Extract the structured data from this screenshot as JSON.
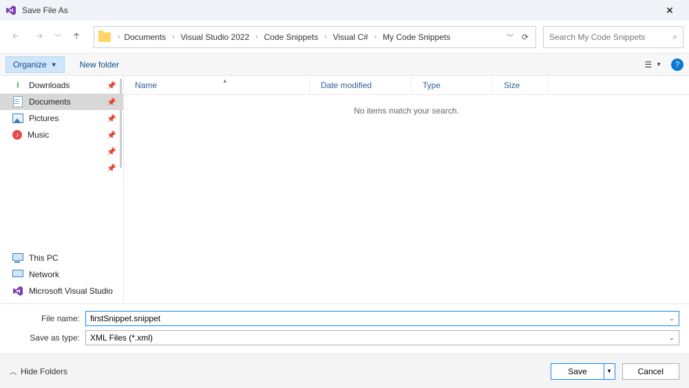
{
  "window": {
    "title": "Save File As"
  },
  "breadcrumbs": [
    "Documents",
    "Visual Studio 2022",
    "Code Snippets",
    "Visual C#",
    "My Code Snippets"
  ],
  "search": {
    "placeholder": "Search My Code Snippets"
  },
  "toolbar": {
    "organize": "Organize",
    "newfolder": "New folder"
  },
  "sidebar": {
    "top": [
      {
        "name": "downloads",
        "label": "Downloads",
        "pinned": true
      },
      {
        "name": "documents",
        "label": "Documents",
        "pinned": true,
        "selected": true
      },
      {
        "name": "pictures",
        "label": "Pictures",
        "pinned": true
      },
      {
        "name": "music",
        "label": "Music",
        "pinned": true
      }
    ],
    "bottom": [
      {
        "name": "this-pc",
        "label": "This PC"
      },
      {
        "name": "network",
        "label": "Network"
      },
      {
        "name": "msvs",
        "label": "Microsoft Visual Studio"
      }
    ]
  },
  "columns": {
    "name": "Name",
    "date": "Date modified",
    "type": "Type",
    "size": "Size"
  },
  "empty_message": "No items match your search.",
  "form": {
    "filename_label": "File name:",
    "filename_value": "firstSnippet.snippet",
    "savetype_label": "Save as type:",
    "savetype_value": "XML Files (*.xml)"
  },
  "footer": {
    "hide": "Hide Folders",
    "save": "Save",
    "cancel": "Cancel"
  }
}
